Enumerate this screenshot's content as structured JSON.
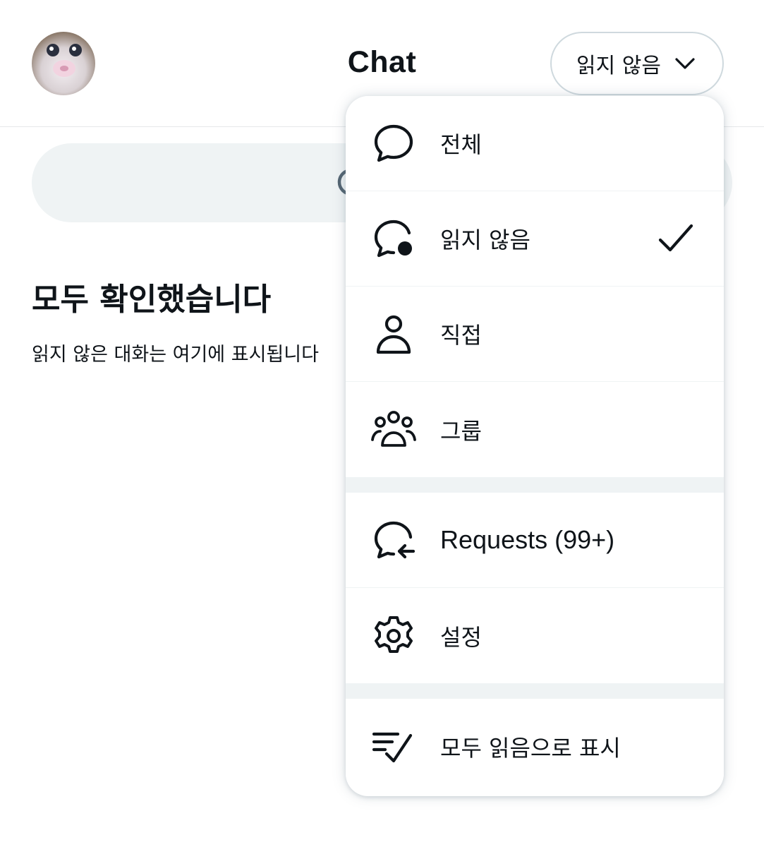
{
  "header": {
    "title": "Chat",
    "filter_label": "읽지 않음"
  },
  "empty_state": {
    "title": "모두 확인했습니다",
    "description": "읽지 않은 대화는 여기에 표시됩니다"
  },
  "menu": {
    "items": [
      {
        "label": "전체",
        "icon": "chat-bubble-icon"
      },
      {
        "label": "읽지 않음",
        "icon": "chat-bubble-unread-icon",
        "selected": true
      },
      {
        "label": "직접",
        "icon": "person-icon"
      },
      {
        "label": "그룹",
        "icon": "group-icon"
      },
      {
        "label": "Requests (99+)",
        "icon": "chat-bubble-incoming-icon"
      },
      {
        "label": "설정",
        "icon": "gear-icon"
      },
      {
        "label": "모두 읽음으로 표시",
        "icon": "mark-all-read-icon"
      }
    ]
  },
  "colors": {
    "text": "#0f1419",
    "border": "#cfd9de",
    "surface": "#eff3f4"
  }
}
